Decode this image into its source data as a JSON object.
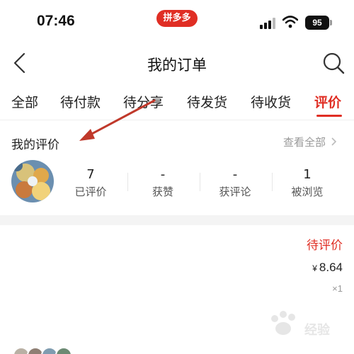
{
  "status_bar": {
    "time": "07:46",
    "app_badge": "拼多多",
    "battery": "95"
  },
  "nav": {
    "title": "我的订单",
    "back_icon": "chevron-left-icon",
    "search_icon": "search-icon"
  },
  "tabs": [
    {
      "label": "全部",
      "active": false
    },
    {
      "label": "待付款",
      "active": false
    },
    {
      "label": "待分享",
      "active": false
    },
    {
      "label": "待发货",
      "active": false
    },
    {
      "label": "待收货",
      "active": false
    },
    {
      "label": "评价",
      "active": true
    }
  ],
  "reviews": {
    "header": "我的评价",
    "view_all": "查看全部",
    "stats": [
      {
        "value": "7",
        "label": "已评价"
      },
      {
        "value": "-",
        "label": "获赞"
      },
      {
        "value": "-",
        "label": "获评论"
      },
      {
        "value": "1",
        "label": "被浏览"
      }
    ]
  },
  "order": {
    "status": "待评价",
    "currency": "¥",
    "price": "8.64",
    "quantity": "×1"
  },
  "watermark": {
    "text": "经验"
  },
  "colors": {
    "accent": "#e02e24",
    "muted": "#999999",
    "annotation_arrow": "#c0392b"
  }
}
